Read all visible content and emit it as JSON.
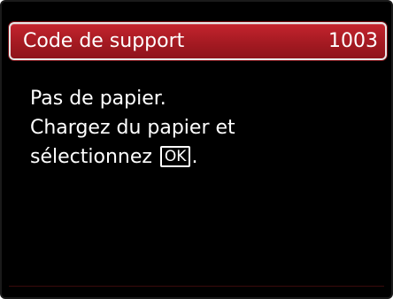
{
  "title_bar": {
    "label": "Code de support",
    "code": "1003"
  },
  "message": {
    "line1": "Pas de papier.",
    "line2": "Chargez du papier et",
    "line3_prefix": "sélectionnez",
    "ok_key_label": "OK",
    "line3_suffix": "."
  },
  "colors": {
    "title_bar": "#a51a22",
    "background": "#000000",
    "text": "#ffffff"
  }
}
